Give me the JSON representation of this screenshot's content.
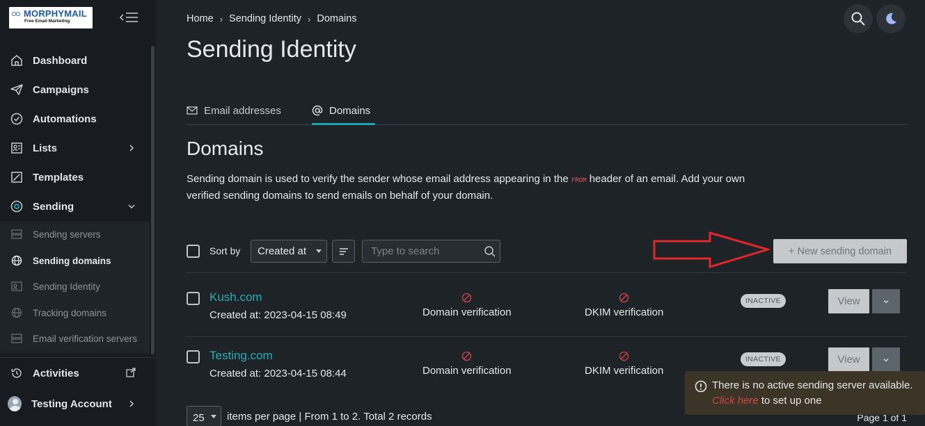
{
  "app": {
    "logo_text": "MORPHYMAIL",
    "logo_tagline": "Free Email Marketing"
  },
  "sidebar": {
    "items": [
      {
        "label": "Dashboard"
      },
      {
        "label": "Campaigns"
      },
      {
        "label": "Automations"
      },
      {
        "label": "Lists"
      },
      {
        "label": "Templates"
      },
      {
        "label": "Sending"
      }
    ],
    "sending_sub": [
      {
        "label": "Sending servers"
      },
      {
        "label": "Sending domains"
      },
      {
        "label": "Sending Identity"
      },
      {
        "label": "Tracking domains"
      },
      {
        "label": "Email verification servers"
      }
    ],
    "activities_label": "Activities",
    "account_label": "Testing Account"
  },
  "breadcrumb": [
    "Home",
    "Sending Identity",
    "Domains"
  ],
  "page_title": "Sending Identity",
  "tabs": [
    {
      "label": "Email addresses"
    },
    {
      "label": "Domains"
    }
  ],
  "section": {
    "title": "Domains",
    "desc_before": "Sending domain is used to verify the sender whose email address appearing in the ",
    "desc_code": "FROM",
    "desc_after": " header of an email. Add your own verified sending domains to send emails on behalf of your domain."
  },
  "toolbar": {
    "sort_label": "Sort by",
    "sort_value": "Created at",
    "search_placeholder": "Type to search",
    "new_button": "+ New sending domain"
  },
  "domains": [
    {
      "name": "Kush.com",
      "created": "Created at: 2023-04-15 08:49",
      "domain_verification": "Domain verification",
      "dkim_verification": "DKIM verification",
      "status": "INACTIVE",
      "view_label": "View"
    },
    {
      "name": "Testing.com",
      "created": "Created at: 2023-04-15 08:44",
      "domain_verification": "Domain verification",
      "dkim_verification": "DKIM verification",
      "status": "INACTIVE",
      "view_label": "View"
    }
  ],
  "pager": {
    "per_page": "25",
    "text": "items per page  | From 1 to 2. Total 2 records",
    "page_of": "Page 1 of 1"
  },
  "toast": {
    "before": "There is no active sending server available. ",
    "link": "Click here",
    "after": " to set up one"
  },
  "colors": {
    "accent": "#1aa3b0",
    "link": "#26aeb8",
    "annotation_arrow": "#e3262a",
    "error": "#d4454a"
  }
}
